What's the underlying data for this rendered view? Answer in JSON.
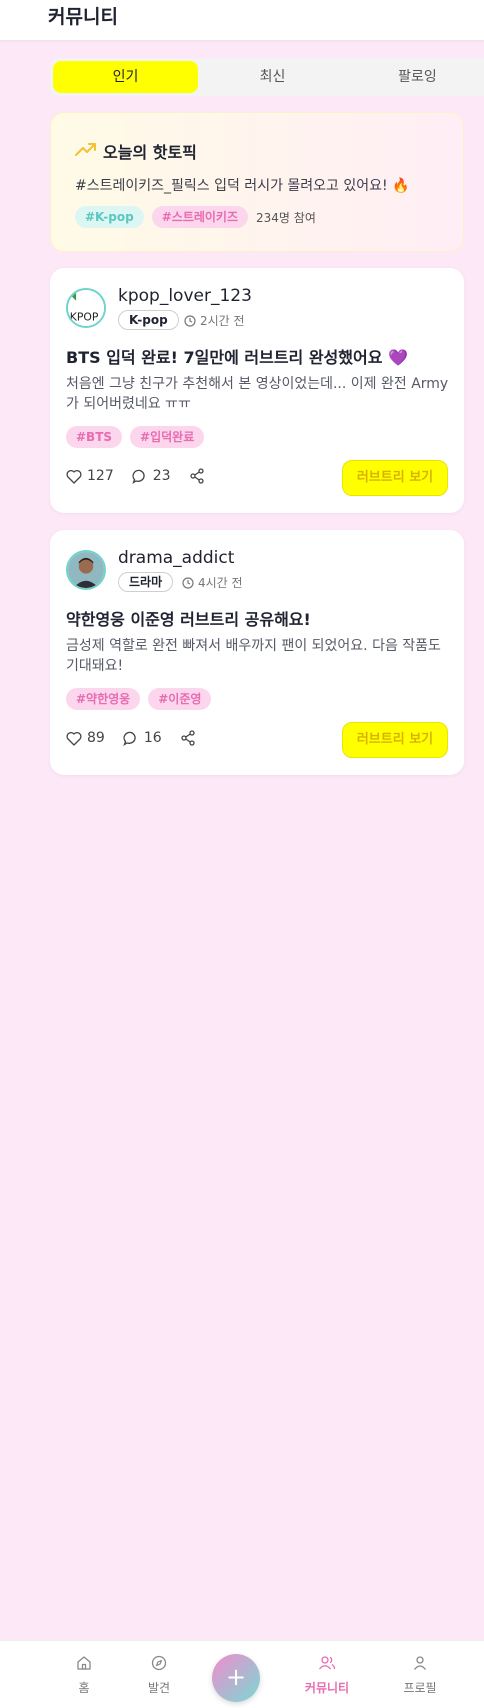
{
  "header": {
    "title": "커뮤니티"
  },
  "tabs": [
    {
      "label": "인기",
      "active": true
    },
    {
      "label": "최신",
      "active": false
    },
    {
      "label": "팔로잉",
      "active": false
    }
  ],
  "hot_topic": {
    "icon": "trending-up-icon",
    "title": "오늘의 핫토픽",
    "text": "#스트레이키즈_필릭스 입덕 러시가 몰려오고 있어요! 🔥",
    "tags": [
      "#K-pop",
      "#스트레이키즈"
    ],
    "participants": "234명 참여"
  },
  "posts": [
    {
      "username": "kpop_lover_123",
      "avatar_alt": "KPOP",
      "category": "K-pop",
      "time": "2시간 전",
      "title": "BTS 입덕 완료! 7일만에 러브트리 완성했어요 💜",
      "body": "처음엔 그냥 친구가 추천해서 본 영상이었는데... 이제 완전 Army가 되어버렸네요 ㅠㅠ",
      "tags": [
        "#BTS",
        "#입덕완료"
      ],
      "likes": "127",
      "comments": "23",
      "view_button": "러브트리 보기"
    },
    {
      "username": "drama_addict",
      "category": "드라마",
      "time": "4시간 전",
      "title": "약한영웅 이준영 러브트리 공유해요!",
      "body": "금성제 역할로 완전 빠져서 배우까지 팬이 되었어요. 다음 작품도 기대돼요!",
      "tags": [
        "#약한영웅",
        "#이준영"
      ],
      "likes": "89",
      "comments": "16",
      "view_button": "러브트리 보기"
    }
  ],
  "bottom_nav": {
    "items": [
      {
        "label": "홈",
        "icon": "home-icon"
      },
      {
        "label": "발견",
        "icon": "compass-icon"
      },
      {
        "label": "커뮤니티",
        "icon": "users-icon",
        "active": true
      },
      {
        "label": "프로필",
        "icon": "user-icon"
      }
    ],
    "fab": "+"
  },
  "colors": {
    "background": "#fde8f7",
    "accent_yellow": "#ffff00",
    "accent_pink": "#e86cb1",
    "accent_teal": "#5cc6c0"
  }
}
